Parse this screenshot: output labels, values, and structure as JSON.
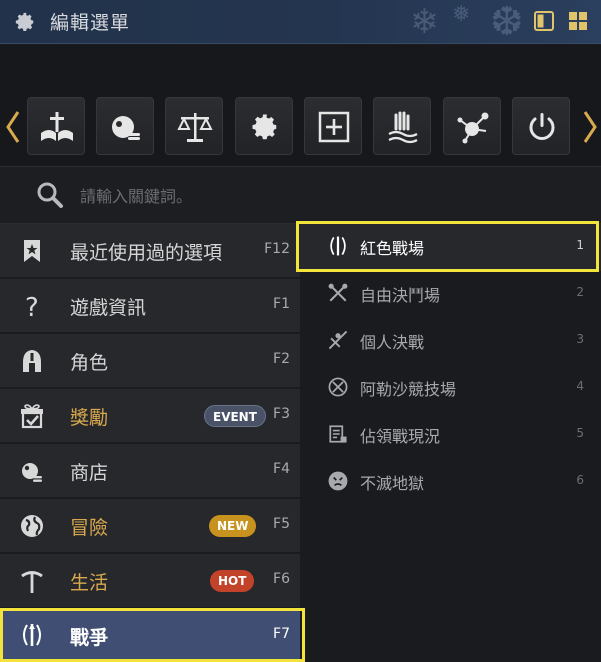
{
  "window": {
    "title": "編輯選單"
  },
  "search": {
    "placeholder": "請輸入關鍵詞。"
  },
  "menu": {
    "items": [
      {
        "label": "最近使用過的選項",
        "key": "F12"
      },
      {
        "label": "遊戲資訊",
        "key": "F1"
      },
      {
        "label": "角色",
        "key": "F2"
      },
      {
        "label": "獎勵",
        "key": "F3",
        "badge": "EVENT"
      },
      {
        "label": "商店",
        "key": "F4"
      },
      {
        "label": "冒險",
        "key": "F5",
        "badge": "NEW"
      },
      {
        "label": "生活",
        "key": "F6",
        "badge": "HOT"
      },
      {
        "label": "戰爭",
        "key": "F7"
      }
    ]
  },
  "submenu": {
    "items": [
      {
        "label": "紅色戰場",
        "num": "1"
      },
      {
        "label": "自由決鬥場",
        "num": "2"
      },
      {
        "label": "個人決戰",
        "num": "3"
      },
      {
        "label": "阿勒沙競技場",
        "num": "4"
      },
      {
        "label": "佔領戰現況",
        "num": "5"
      },
      {
        "label": "不滅地獄",
        "num": "6"
      }
    ]
  },
  "toolbar": {
    "icons": [
      "knowledge-icon",
      "shop-icon",
      "scale-icon",
      "settings-icon",
      "add-icon",
      "guild-icon",
      "network-icon",
      "power-icon"
    ]
  },
  "colors": {
    "accent_gold": "#d9a94e",
    "highlight": "#f2e43a",
    "active_bg": "#3f4e72",
    "event": "#4a5268",
    "new": "#c8921e",
    "hot": "#c2432a"
  }
}
